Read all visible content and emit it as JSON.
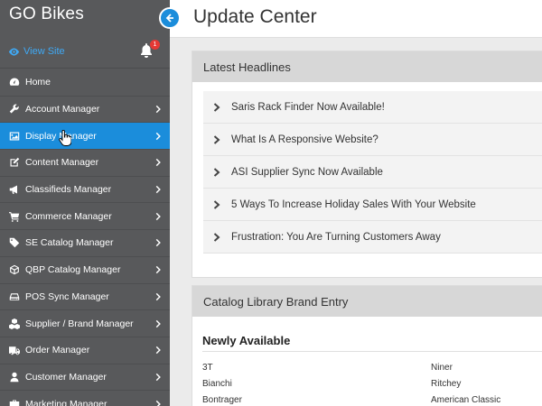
{
  "app": {
    "brand": "GO Bikes",
    "view_site": "View Site",
    "notification_count": "1"
  },
  "sidebar": {
    "items": [
      {
        "label": "Home",
        "icon": "dashboard-icon",
        "has_chevron": false
      },
      {
        "label": "Account Manager",
        "icon": "wrench-icon",
        "has_chevron": true
      },
      {
        "label": "Display Manager",
        "icon": "image-icon",
        "has_chevron": true,
        "active": true
      },
      {
        "label": "Content Manager",
        "icon": "edit-icon",
        "has_chevron": true
      },
      {
        "label": "Classifieds Manager",
        "icon": "megaphone-icon",
        "has_chevron": true
      },
      {
        "label": "Commerce Manager",
        "icon": "cart-icon",
        "has_chevron": true
      },
      {
        "label": "SE Catalog Manager",
        "icon": "tag-icon",
        "has_chevron": true
      },
      {
        "label": "QBP Catalog Manager",
        "icon": "cube-icon",
        "has_chevron": true
      },
      {
        "label": "POS Sync Manager",
        "icon": "hdd-icon",
        "has_chevron": true
      },
      {
        "label": "Supplier / Brand Manager",
        "icon": "cubes-icon",
        "has_chevron": true
      },
      {
        "label": "Order Manager",
        "icon": "truck-icon",
        "has_chevron": true
      },
      {
        "label": "Customer Manager",
        "icon": "user-icon",
        "has_chevron": true
      },
      {
        "label": "Marketing Manager",
        "icon": "briefcase-icon",
        "has_chevron": true
      }
    ]
  },
  "header": {
    "title": "Update Center"
  },
  "headlines_panel": {
    "title": "Latest Headlines",
    "items": [
      "Saris Rack Finder Now Available!",
      "What Is A Responsive Website?",
      "ASI Supplier Sync Now Available",
      "5 Ways To Increase Holiday Sales With Your Website",
      "Frustration: You Are Turning Customers Away"
    ]
  },
  "catalog_panel": {
    "title": "Catalog Library Brand Entry",
    "section_title": "Newly Available",
    "brands_left": [
      "3T",
      "Bianchi",
      "Bontrager"
    ],
    "brands_right": [
      "Niner",
      "Ritchey",
      "American Classic"
    ]
  },
  "colors": {
    "sidebar_bg": "#58595b",
    "accent": "#1b8ddb",
    "view_site_link": "#3fa9f5",
    "badge": "#e53935",
    "panel_header": "#d7d7d7"
  }
}
